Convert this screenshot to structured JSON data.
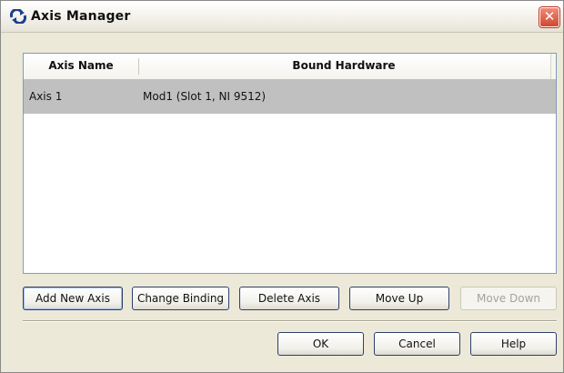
{
  "window": {
    "title": "Axis Manager",
    "close_glyph": "✕",
    "app_icon": "axis-manager-icon"
  },
  "table": {
    "columns": [
      "Axis Name",
      "Bound Hardware"
    ],
    "rows": [
      {
        "axis_name": "Axis 1",
        "bound_hardware": "Mod1 (Slot 1, NI 9512)"
      }
    ]
  },
  "actions": {
    "add_new_axis": "Add New Axis",
    "change_binding": "Change Binding",
    "delete_axis": "Delete Axis",
    "move_up": "Move Up",
    "move_down": "Move Down"
  },
  "dialog_buttons": {
    "ok": "OK",
    "cancel": "Cancel",
    "help": "Help"
  },
  "colors": {
    "selected_row": "#c0c0c0",
    "close_button": "#d2472f",
    "button_border": "#2e3f6e"
  }
}
